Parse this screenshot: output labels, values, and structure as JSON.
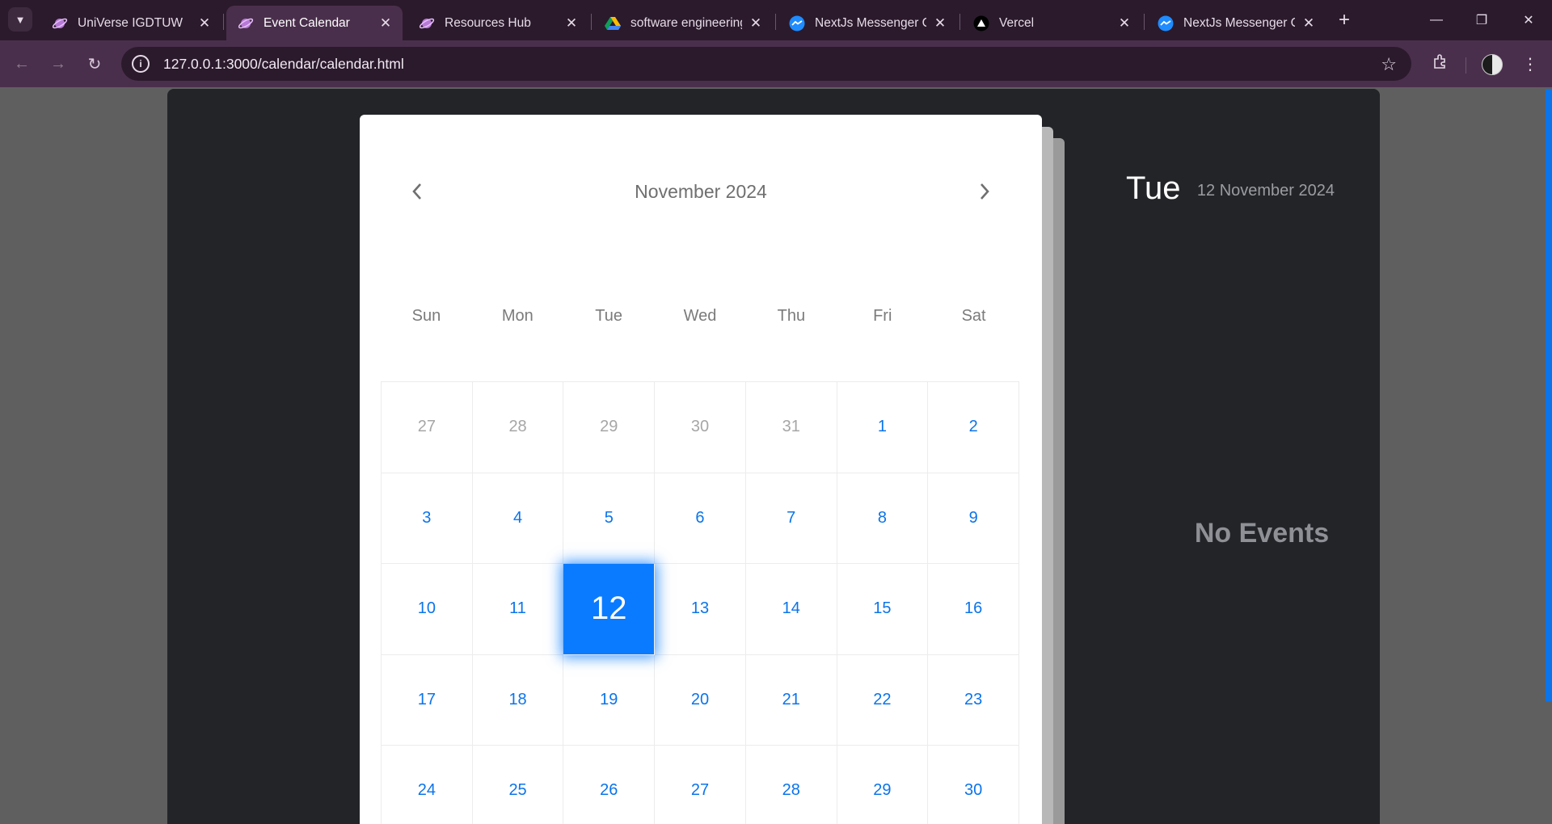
{
  "browser": {
    "tabs": [
      {
        "title": "UniVerse IGDTUW",
        "icon": "universe-favicon",
        "active": false
      },
      {
        "title": "Event Calendar",
        "icon": "universe-favicon",
        "active": true
      },
      {
        "title": "Resources Hub",
        "icon": "universe-favicon",
        "active": false
      },
      {
        "title": "software engineering",
        "icon": "google-drive-favicon",
        "active": false
      },
      {
        "title": "NextJs Messenger Cl",
        "icon": "messenger-favicon",
        "active": false
      },
      {
        "title": "Vercel",
        "icon": "vercel-favicon",
        "active": false
      },
      {
        "title": "NextJs Messenger Cl",
        "icon": "messenger-favicon",
        "active": false
      }
    ],
    "url": "127.0.0.1:3000/calendar/calendar.html",
    "colors": {
      "frame": "#2b1a2c",
      "toolbar": "#4a2f4c",
      "active_tab": "#4a2f4c"
    }
  },
  "calendar": {
    "month_title": "November 2024",
    "weekdays": [
      "Sun",
      "Mon",
      "Tue",
      "Wed",
      "Thu",
      "Fri",
      "Sat"
    ],
    "days": [
      {
        "label": "27",
        "muted": true
      },
      {
        "label": "28",
        "muted": true
      },
      {
        "label": "29",
        "muted": true
      },
      {
        "label": "30",
        "muted": true
      },
      {
        "label": "31",
        "muted": true
      },
      {
        "label": "1"
      },
      {
        "label": "2"
      },
      {
        "label": "3"
      },
      {
        "label": "4"
      },
      {
        "label": "5"
      },
      {
        "label": "6"
      },
      {
        "label": "7"
      },
      {
        "label": "8"
      },
      {
        "label": "9"
      },
      {
        "label": "10"
      },
      {
        "label": "11"
      },
      {
        "label": "12",
        "today": true
      },
      {
        "label": "13"
      },
      {
        "label": "14"
      },
      {
        "label": "15"
      },
      {
        "label": "16"
      },
      {
        "label": "17"
      },
      {
        "label": "18"
      },
      {
        "label": "19"
      },
      {
        "label": "20"
      },
      {
        "label": "21"
      },
      {
        "label": "22"
      },
      {
        "label": "23"
      },
      {
        "label": "24"
      },
      {
        "label": "25"
      },
      {
        "label": "26"
      },
      {
        "label": "27"
      },
      {
        "label": "28"
      },
      {
        "label": "29"
      },
      {
        "label": "30"
      }
    ],
    "colors": {
      "accent": "#0a7bff",
      "day_text": "#0b74ea",
      "muted_text": "#a6a6a6"
    }
  },
  "side_panel": {
    "day_name": "Tue",
    "full_date": "12 November 2024",
    "empty_message": "No Events",
    "colors": {
      "background": "#222428"
    }
  }
}
